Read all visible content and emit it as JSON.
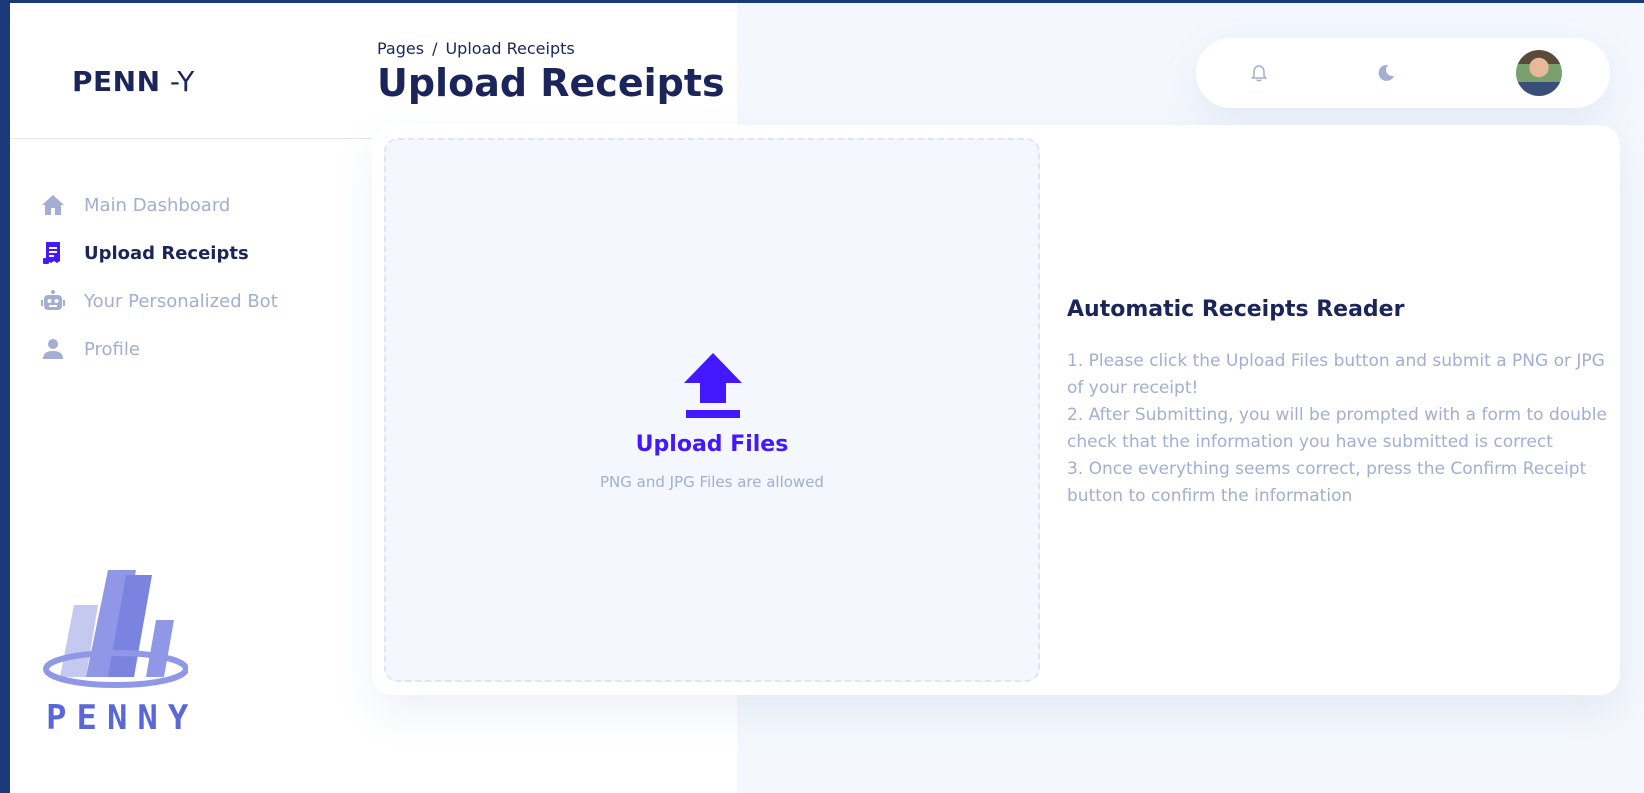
{
  "sidebar": {
    "brand_bold": "PENN",
    "brand_thin": " -Y",
    "items": [
      {
        "label": "Main Dashboard",
        "icon": "home-icon",
        "active": false
      },
      {
        "label": "Upload Receipts",
        "icon": "receipt-icon",
        "active": true
      },
      {
        "label": "Your Personalized Bot",
        "icon": "robot-icon",
        "active": false
      },
      {
        "label": "Profile",
        "icon": "person-icon",
        "active": false
      }
    ],
    "logo_text": "PENNY"
  },
  "header": {
    "breadcrumb_root": "Pages",
    "breadcrumb_sep": "/",
    "breadcrumb_current": "Upload Receipts",
    "title": "Upload Receipts"
  },
  "topbar": {
    "icons": [
      "bell-icon",
      "moon-icon",
      "avatar"
    ]
  },
  "upload": {
    "title": "Upload Files",
    "subtitle": "PNG and JPG Files are allowed",
    "icon": "upload-icon"
  },
  "info": {
    "title": "Automatic Receipts Reader",
    "lines": [
      "1. Please click the Upload Files button and submit a PNG or JPG of your receipt!",
      "2. After Submitting, you will be prompted with a form to double check that the information you have submitted is correct",
      "3. Once everything seems correct, press the Confirm Receipt button to confirm the information"
    ]
  },
  "colors": {
    "accent": "#4318ff",
    "text_dark": "#1b2559",
    "text_muted": "#a3aed0",
    "background": "#f4f7fe",
    "logo": "#5a67d8"
  }
}
